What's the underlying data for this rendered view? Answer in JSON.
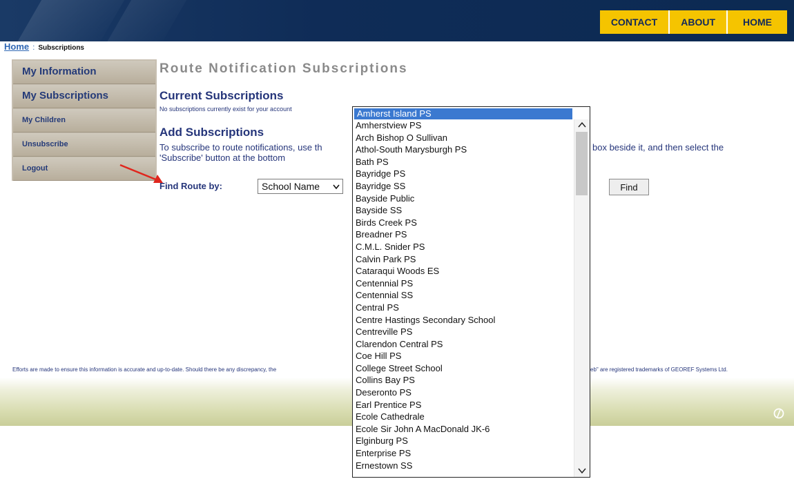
{
  "nav": {
    "contact": "CONTACT",
    "about": "ABOUT",
    "home": "HOME"
  },
  "breadcrumb": {
    "home": "Home",
    "separator": ":",
    "current": "Subscriptions"
  },
  "sidebar": {
    "items": [
      {
        "label": "My Information"
      },
      {
        "label": "My Subscriptions"
      },
      {
        "label": "My Children"
      },
      {
        "label": "Unsubscribe"
      },
      {
        "label": "Logout"
      }
    ]
  },
  "main": {
    "title": "Route Notification Subscriptions",
    "current_heading": "Current Subscriptions",
    "current_note": "No subscriptions currently exist for your account",
    "add_heading": "Add Subscriptions",
    "instruction_left_line1": "To subscribe to route notifications, use th",
    "instruction_left_line2": "'Subscribe' button at the bottom",
    "instruction_right": "box beside it, and then select the",
    "find_label": "Find Route by:",
    "find_by_value": "School Name",
    "find_button": "Find"
  },
  "dropdown": {
    "selected": "Amherst Island PS",
    "options": [
      "Amherstview PS",
      "Arch Bishop O Sullivan",
      "Athol-South Marysburgh PS",
      "Bath PS",
      "Bayridge PS",
      "Bayridge SS",
      "Bayside Public",
      "Bayside SS",
      "Birds Creek PS",
      "Breadner PS",
      "C.M.L. Snider PS",
      "Calvin Park PS",
      "Cataraqui Woods ES",
      "Centennial PS",
      "Centennial SS",
      "Central PS",
      "Centre Hastings Secondary School",
      "Centreville PS",
      "Clarendon Central PS",
      "Coe Hill PS",
      "College Street School",
      "Collins Bay PS",
      "Deseronto PS",
      "Earl Prentice PS",
      "Ecole Cathedrale",
      "Ecole Sir John A MacDonald JK-6",
      "Elginburg PS",
      "Enterprise PS",
      "Ernestown SS"
    ]
  },
  "footer": {
    "disclaimer_left": "Efforts are made to ensure this information is accurate and up-to-date. Should there be any discrepancy, the",
    "disclaimer_right": "eb\" are registered trademarks of GEOREF Systems Ltd."
  },
  "colors": {
    "nav_bg": "#f5c400",
    "header_bg": "#0f2c57",
    "heading_text": "#25357a",
    "selected_option": "#3b79d0",
    "sidebar_bg": "#c7bfb1"
  }
}
